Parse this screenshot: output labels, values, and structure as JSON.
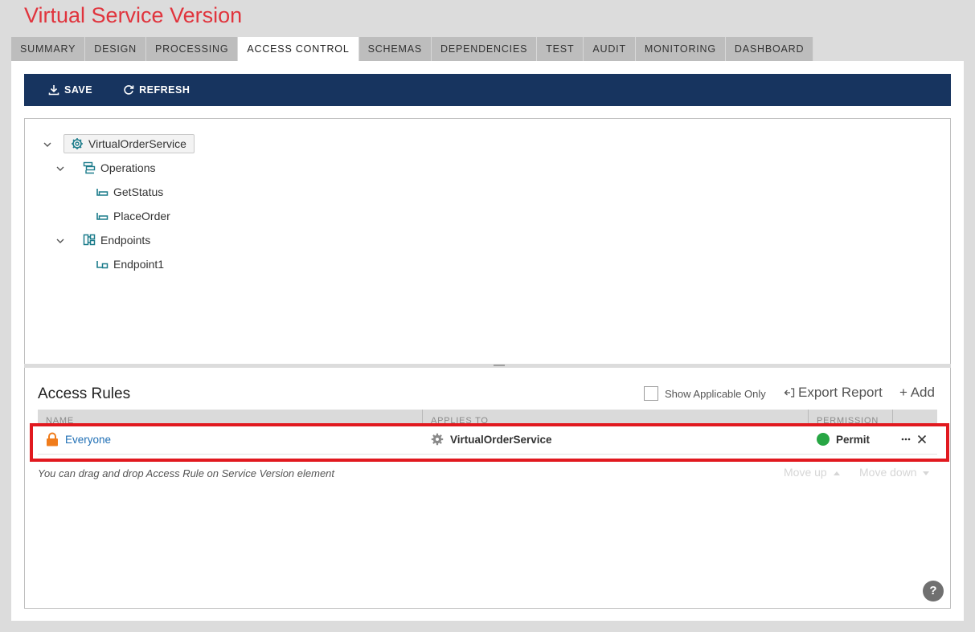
{
  "page": {
    "title": "Virtual Service Version"
  },
  "tabs": [
    {
      "label": "SUMMARY"
    },
    {
      "label": "DESIGN"
    },
    {
      "label": "PROCESSING"
    },
    {
      "label": "ACCESS CONTROL",
      "active": true
    },
    {
      "label": "SCHEMAS"
    },
    {
      "label": "DEPENDENCIES"
    },
    {
      "label": "TEST"
    },
    {
      "label": "AUDIT"
    },
    {
      "label": "MONITORING"
    },
    {
      "label": "DASHBOARD"
    }
  ],
  "toolbar": {
    "save_label": "SAVE",
    "refresh_label": "REFRESH"
  },
  "tree": {
    "root": {
      "label": "VirtualOrderService",
      "icon": "gear-icon"
    },
    "operations": {
      "label": "Operations",
      "icon": "operations-icon",
      "items": [
        "GetStatus",
        "PlaceOrder"
      ]
    },
    "endpoints": {
      "label": "Endpoints",
      "icon": "endpoints-icon",
      "items": [
        "Endpoint1"
      ]
    }
  },
  "access_rules": {
    "title": "Access Rules",
    "show_applicable_only_label": "Show Applicable Only",
    "show_applicable_only_checked": false,
    "export_label": "Export Report",
    "add_label": "+ Add",
    "columns": {
      "name": "NAME",
      "applies_to": "APPLIES TO",
      "permission": "PERMISSION"
    },
    "rows": [
      {
        "name": "Everyone",
        "applies_to": "VirtualOrderService",
        "permission": "Permit"
      }
    ],
    "hint": "You can drag and drop Access Rule on Service Version element",
    "move_up_label": "Move up",
    "move_down_label": "Move down"
  },
  "colors": {
    "title_red": "#e0343d",
    "toolbar_navy": "#17345f",
    "permit_green": "#27a644",
    "lock_orange": "#f07c1b",
    "highlight_red": "#e1191f",
    "link_blue": "#1f6fb5"
  },
  "help_label": "?"
}
